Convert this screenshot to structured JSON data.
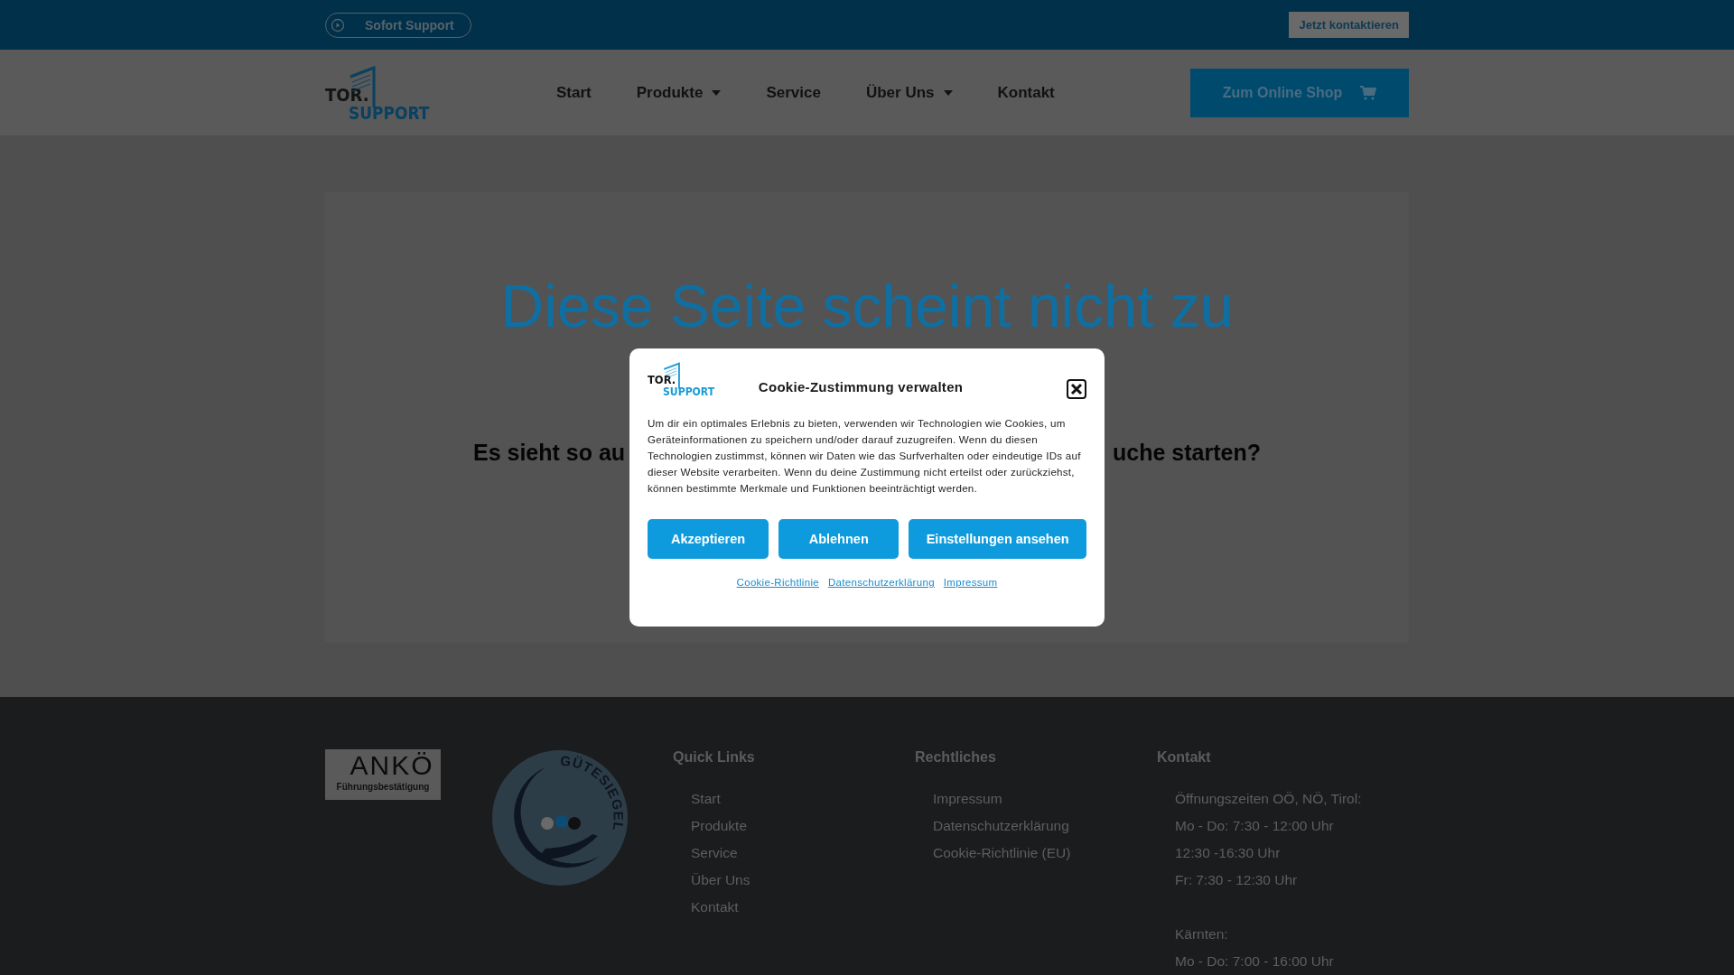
{
  "top_bar": {
    "support_pill": "Sofort Support",
    "contact_button": "Jetzt kontaktieren"
  },
  "header": {
    "logo": {
      "line1": "TOR.",
      "line2": "SUPPORT"
    },
    "nav": [
      {
        "label": "Start",
        "dropdown": false
      },
      {
        "label": "Produkte",
        "dropdown": true
      },
      {
        "label": "Service",
        "dropdown": false
      },
      {
        "label": "Über Uns",
        "dropdown": true
      },
      {
        "label": "Kontakt",
        "dropdown": false
      }
    ],
    "shop_button": "Zum Online Shop"
  },
  "error_card": {
    "heading": "Diese Seite scheint nicht zu",
    "subtitle_left": "Es sieht so au",
    "subtitle_right": "uche starten?"
  },
  "cookie_dialog": {
    "logo": {
      "line1": "TOR.",
      "line2": "SUPPORT"
    },
    "title": "Cookie-Zustimmung verwalten",
    "text": "Um dir ein optimales Erlebnis zu bieten, verwenden wir Technologien wie Cookies, um Geräteinformationen zu speichern und/oder darauf zuzugreifen. Wenn du diesen Technologien zustimmst, können wir Daten wie das Surfverhalten oder eindeutige IDs auf dieser Website verarbeiten. Wenn du deine Zustimmung nicht erteilst oder zurückziehst, können bestimmte Merkmale und Funktionen beeinträchtigt werden.",
    "buttons": [
      "Akzeptieren",
      "Ablehnen",
      "Einstellungen ansehen"
    ],
    "links": [
      "Cookie-Richtlinie",
      "Datenschutzerklärung",
      "Impressum"
    ]
  },
  "footer": {
    "anko_badge": {
      "name": "ANKÖ",
      "caption": "Führungsbestätigung"
    },
    "seal": "GÜTESIEGEL",
    "columns": [
      {
        "heading": "Quick Links",
        "items": [
          "Start",
          "Produkte",
          "Service",
          "Über Uns",
          "Kontakt"
        ]
      },
      {
        "heading": "Rechtliches",
        "items": [
          "Impressum",
          "Datenschutzerklärung",
          "Cookie-Richtlinie (EU)"
        ]
      },
      {
        "heading": "Kontakt",
        "groups": [
          [
            "Öffnungszeiten OÖ, NÖ, Tirol:",
            "Mo - Do: 7:30 - 12:00 Uhr",
            "12:30 -16:30 Uhr",
            "Fr: 7:30 - 12:30 Uhr"
          ],
          [
            "Kärnten:",
            "Mo - Do: 7:00 - 16:00 Uhr"
          ]
        ]
      }
    ]
  }
}
